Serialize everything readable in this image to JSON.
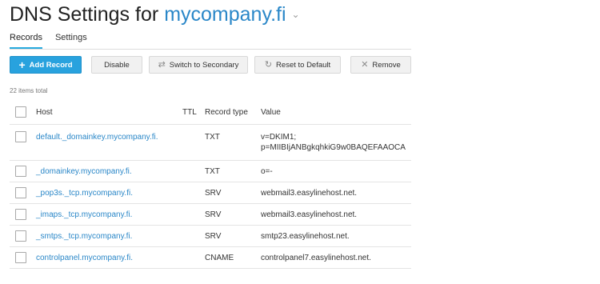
{
  "header": {
    "title_prefix": "DNS Settings for",
    "domain": "mycompany.fi",
    "caret": "⌄"
  },
  "tabs": [
    {
      "label": "Records",
      "active": true
    },
    {
      "label": "Settings",
      "active": false
    }
  ],
  "toolbar": {
    "add_record": {
      "label": "Add Record",
      "icon": "plus-icon"
    },
    "disable": {
      "label": "Disable"
    },
    "switch_secondary": {
      "label": "Switch to Secondary",
      "icon": "switch-icon"
    },
    "reset_default": {
      "label": "Reset to Default",
      "icon": "reset-icon"
    },
    "remove": {
      "label": "Remove",
      "icon": "close-icon"
    }
  },
  "item_count": "22 items total",
  "columns": {
    "host": "Host",
    "ttl": "TTL",
    "type": "Record type",
    "value": "Value"
  },
  "records": [
    {
      "host": "default._domainkey.mycompany.fi.",
      "ttl": "",
      "type": "TXT",
      "value_line1": "v=DKIM1;",
      "value_line2": "p=MIIBIjANBgkqhkiG9w0BAQEFAAOCA"
    },
    {
      "host": "_domainkey.mycompany.fi.",
      "ttl": "",
      "type": "TXT",
      "value": "o=-"
    },
    {
      "host": "_pop3s._tcp.mycompany.fi.",
      "ttl": "",
      "type": "SRV",
      "value": "webmail3.easylinehost.net."
    },
    {
      "host": "_imaps._tcp.mycompany.fi.",
      "ttl": "",
      "type": "SRV",
      "value": "webmail3.easylinehost.net."
    },
    {
      "host": "_smtps._tcp.mycompany.fi.",
      "ttl": "",
      "type": "SRV",
      "value": "smtp23.easylinehost.net."
    },
    {
      "host": "controlpanel.mycompany.fi.",
      "ttl": "",
      "type": "CNAME",
      "value": "controlpanel7.easylinehost.net."
    }
  ],
  "colors": {
    "accent": "#28a2de",
    "link": "#2a87c8"
  }
}
